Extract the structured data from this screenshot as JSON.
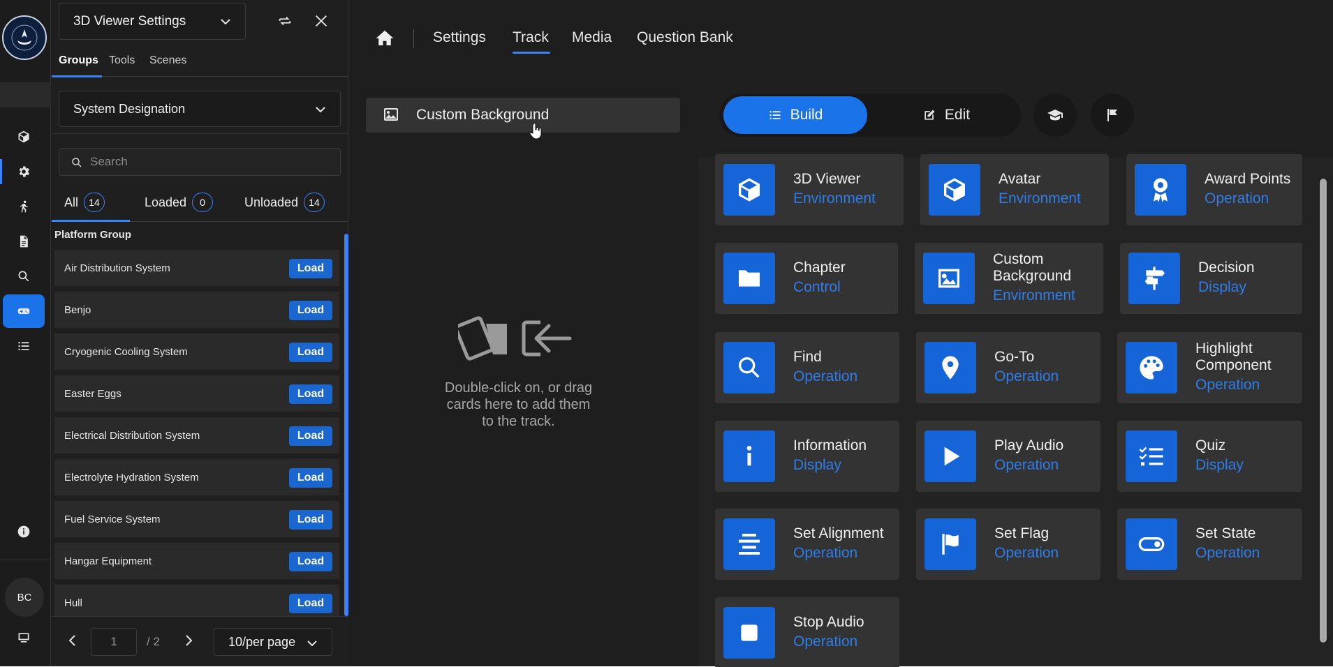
{
  "rail": {
    "avatar_initials": "BC"
  },
  "panel": {
    "viewer_select": "3D Viewer Settings",
    "tabs": [
      "Groups",
      "Tools",
      "Scenes"
    ],
    "group_select": "System Designation",
    "search_placeholder": "Search",
    "filters": [
      {
        "label": "All",
        "count": "14"
      },
      {
        "label": "Loaded",
        "count": "0"
      },
      {
        "label": "Unloaded",
        "count": "14"
      }
    ],
    "group_title": "Platform Group",
    "load_label": "Load",
    "items": [
      "Air Distribution System",
      "Benjo",
      "Cryogenic Cooling System",
      "Easter Eggs",
      "Electrical Distribution System",
      "Electrolyte Hydration System",
      "Fuel Service System",
      "Hangar Equipment",
      "Hull"
    ],
    "pager": {
      "current_page": "1",
      "total": "/ 2",
      "per_page": "10/per page"
    }
  },
  "nav": {
    "links": [
      "Settings",
      "Track",
      "Media",
      "Question Bank"
    ],
    "active": "Track"
  },
  "track": {
    "card_label": "Custom Background",
    "empty_line1": "Double-click on, or drag",
    "empty_line2": "cards here to add them",
    "empty_line3": "to the track."
  },
  "library": {
    "build_label": "Build",
    "edit_label": "Edit",
    "cards": [
      {
        "name": "3D Viewer",
        "category": "Environment",
        "icon": "cube-icon"
      },
      {
        "name": "Avatar",
        "category": "Environment",
        "icon": "cube-icon"
      },
      {
        "name": "Award Points",
        "category": "Operation",
        "icon": "award-icon"
      },
      {
        "name": "Chapter",
        "category": "Control",
        "icon": "folder-icon"
      },
      {
        "name": "Custom Background",
        "category": "Environment",
        "icon": "image-icon"
      },
      {
        "name": "Decision",
        "category": "Display",
        "icon": "signpost-icon"
      },
      {
        "name": "Find",
        "category": "Operation",
        "icon": "search-icon"
      },
      {
        "name": "Go-To",
        "category": "Operation",
        "icon": "location-pin-icon"
      },
      {
        "name": "Highlight Component",
        "category": "Operation",
        "icon": "palette-icon"
      },
      {
        "name": "Information",
        "category": "Display",
        "icon": "info-icon"
      },
      {
        "name": "Play Audio",
        "category": "Operation",
        "icon": "play-icon"
      },
      {
        "name": "Quiz",
        "category": "Display",
        "icon": "checklist-icon"
      },
      {
        "name": "Set Alignment",
        "category": "Operation",
        "icon": "align-center-icon"
      },
      {
        "name": "Set Flag",
        "category": "Operation",
        "icon": "flag-icon"
      },
      {
        "name": "Set State",
        "category": "Operation",
        "icon": "toggle-icon"
      },
      {
        "name": "Stop Audio",
        "category": "Operation",
        "icon": "stop-icon"
      }
    ]
  },
  "colors": {
    "accent": "#1a73e8",
    "card_icon_bg": "#1565d8",
    "category_text": "#2f7de8"
  }
}
